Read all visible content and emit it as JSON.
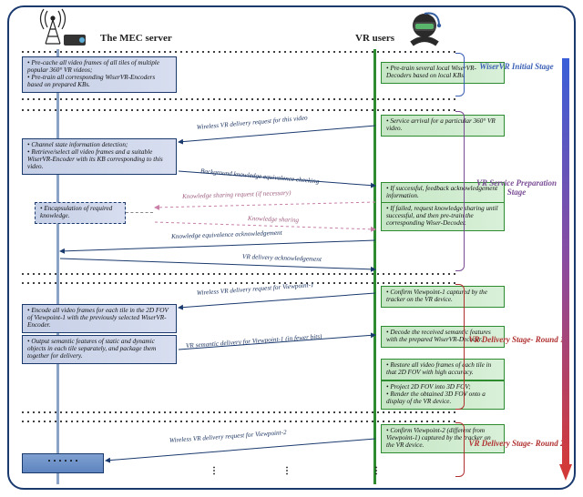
{
  "headers": {
    "mec": "The MEC server",
    "vr": "VR users"
  },
  "stages": {
    "s1": "WiserVR  Initial Stage",
    "s2": "VR Service Preparation Stage",
    "s3": "VR Delivery Stage- Round 1",
    "s4": "VR Delivery Stage- Round 2"
  },
  "mec_boxes": {
    "b1": [
      "Pre-cache all video frames of all tiles of multiple popular 360° VR videos;",
      "Pre-train all corresponding WiserVR-Encoders based on prepared KBs."
    ],
    "b2": [
      "Channel state information detection;",
      "Retrieve/select all video frames and a suitable WiserVR-Encoder with its KB corresponding to this video."
    ],
    "b3": [
      "Encapsulation of required knowledge."
    ],
    "b4": [
      "Encode all video frames for each tile in the 2D FOV of Viewpoint-1 with the previously selected WiserVR-Encoder."
    ],
    "b5": [
      "Output semantic features of static and dynamic objects in each tile separately, and package them together for delivery."
    ]
  },
  "vr_boxes": {
    "g1": [
      "Pre-train several local WiserVR-Decoders based on local KBs."
    ],
    "g2": [
      "Service arrival for a particular 360° VR video."
    ],
    "g3": [
      "If successful, feedback acknowledgement information."
    ],
    "g4": [
      "If failed, request knowledge sharing until successful, and then pre-train the corresponding Wiser-Decoder."
    ],
    "g5": [
      "Confirm Viewpoint-1 captured by the tracker on the VR device."
    ],
    "g6": [
      "Decode the received semantic features with the prepared WiserVR-Decoder."
    ],
    "g7": [
      "Restore all video frames of each tile in that 2D FOV with high accuracy."
    ],
    "g8": [
      "Project 2D FOV into 3D FOV;",
      "Render the obtained 3D FOV onto a display of the VR device."
    ],
    "g9": [
      "Confirm Viewpoint-2 (different from Viewpoint-1) captured by the tracker on the VR device."
    ]
  },
  "messages": {
    "m1": "Wireless VR delivery request for this video",
    "m2": "Background knowledge equivalence checking",
    "m3": "Knowledge sharing request (if necessary)",
    "m4": "Knowledge sharing",
    "m5": "Knowledge equivalence acknowledgement",
    "m6": "VR delivery acknowledgement",
    "m7": "Wireless VR delivery request for Viewpoint-1",
    "m8": "VR semantic delivery for Viewpoint-1 (in fewer bits)",
    "m9": "Wireless VR delivery request for Viewpoint-2"
  },
  "ellipsis": "∙  ∙  ∙  ∙  ∙  ∙"
}
